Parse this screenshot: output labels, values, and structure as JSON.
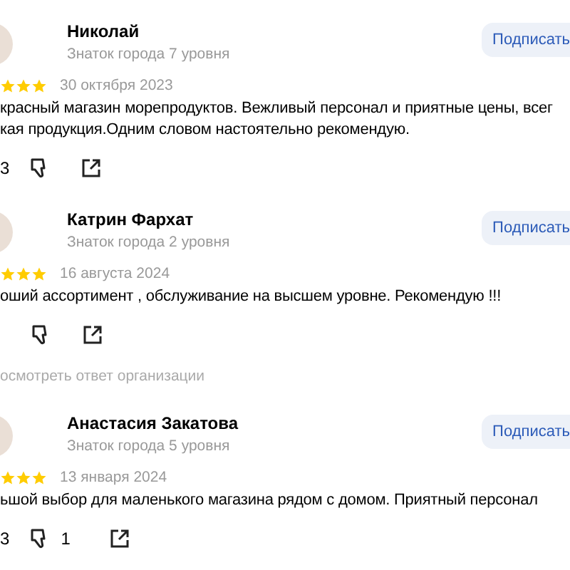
{
  "reviews": [
    {
      "name": "Николай",
      "level": "Знаток города 7 уровня",
      "subscribe": "Подписать",
      "stars": 3,
      "date": "30 октября 2023",
      "text": [
        "красный магазин морепродуктов. Вежливый персонал и приятные цены, всег",
        "кая продукция.Одним словом настоятельно рекомендую."
      ],
      "likes": "3"
    },
    {
      "name": "Катрин Фархат",
      "level": "Знаток города 2 уровня",
      "subscribe": "Подписать",
      "stars": 3,
      "date": "16 августа 2024",
      "text": [
        "оший ассортимент , обслуживание на высшем уровне. Рекомендую !!!"
      ],
      "reply_link": "осмотреть ответ организации"
    },
    {
      "name": "Анастасия Закатова",
      "level": "Знаток города 5 уровня",
      "subscribe": "Подписать",
      "stars": 3,
      "date": "13 января 2024",
      "text": [
        "ьшой выбор для маленького магазина рядом с домом. Приятный персонал"
      ],
      "likes": "3",
      "dislikes": "1"
    }
  ]
}
